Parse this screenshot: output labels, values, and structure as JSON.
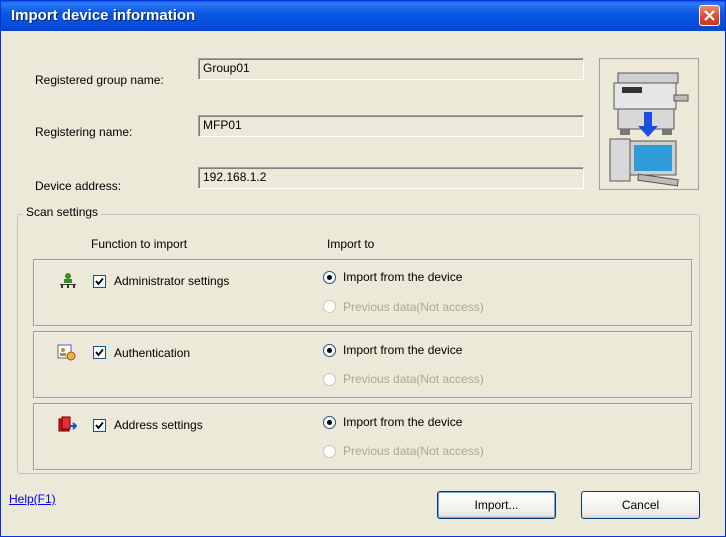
{
  "window": {
    "title": "Import device information"
  },
  "fields": {
    "group_label": "Registered group name:",
    "group_value": "Group01",
    "register_label": "Registering name:",
    "register_value": "MFP01",
    "address_label": "Device address:",
    "address_value": "192.168.1.2"
  },
  "scan": {
    "title": "Scan settings",
    "col_function": "Function to import",
    "col_import_to": "Import to",
    "rows": [
      {
        "label": "Administrator settings",
        "checked": true,
        "icon": "administrator-icon",
        "option1": "Import from the device",
        "option2": "Previous data(Not access)",
        "selected": 1
      },
      {
        "label": "Authentication",
        "checked": true,
        "icon": "authentication-icon",
        "option1": "Import from the device",
        "option2": "Previous data(Not access)",
        "selected": 1
      },
      {
        "label": "Address settings",
        "checked": true,
        "icon": "address-book-icon",
        "option1": "Import from the device",
        "option2": "Previous data(Not access)",
        "selected": 1
      }
    ]
  },
  "footer": {
    "help": "Help(F1)",
    "import": "Import...",
    "cancel": "Cancel"
  },
  "colors": {
    "titlebar": "#0551e0",
    "window_bg": "#ece9d8",
    "link": "#0000ff",
    "close": "#d8482a"
  }
}
